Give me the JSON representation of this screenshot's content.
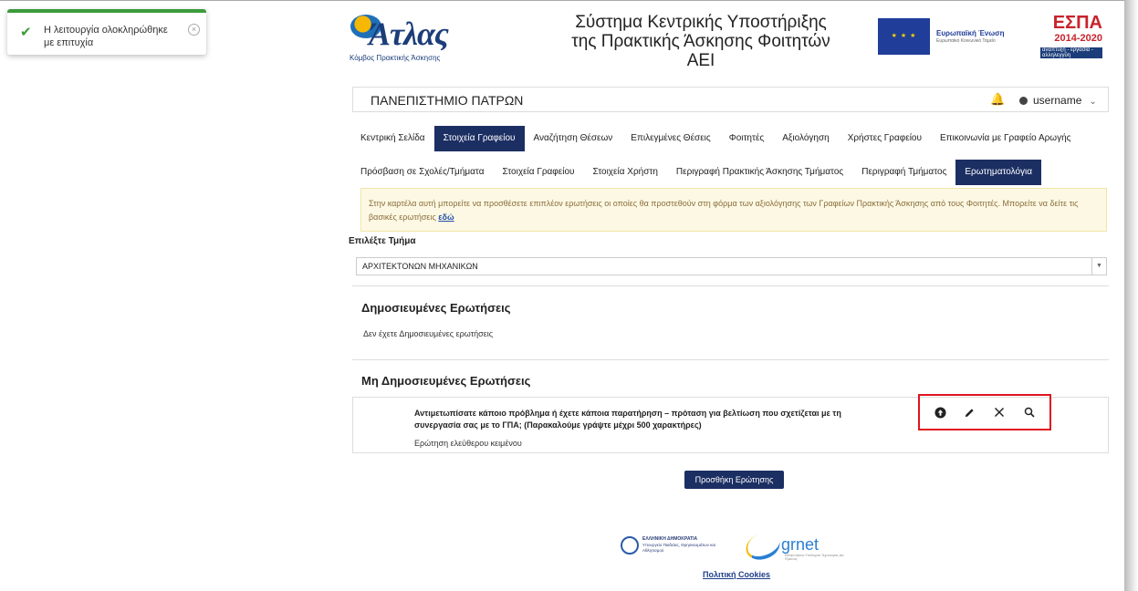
{
  "toast": {
    "message": "Η λειτουργία ολοκληρώθηκε με επιτυχία"
  },
  "header": {
    "logo_name": "Άτλας",
    "logo_sub": "Κόμβος Πρακτικής Άσκησης",
    "site_title": "Σύστημα Κεντρικής Υποστήριξης της Πρακτικής Άσκησης Φοιτητών ΑΕΙ",
    "eu_label": "Ευρωπαϊκή Ένωση",
    "eu_sub": "Ευρωπαϊκό Κοινωνικό Ταμείο",
    "espa_title": "ΕΣΠΑ",
    "espa_years": "2014-2020",
    "espa_tag": "ανάπτυξη - εργασία - αλληλεγγύη"
  },
  "topbar": {
    "institution": "ΠΑΝΕΠΙΣΤΗΜΙΟ ΠΑΤΡΩΝ",
    "username": "username"
  },
  "nav_primary": [
    {
      "label": "Κεντρική Σελίδα",
      "active": false
    },
    {
      "label": "Στοιχεία Γραφείου",
      "active": true
    },
    {
      "label": "Αναζήτηση Θέσεων",
      "active": false
    },
    {
      "label": "Επιλεγμένες Θέσεις",
      "active": false
    },
    {
      "label": "Φοιτητές",
      "active": false
    },
    {
      "label": "Αξιολόγηση",
      "active": false
    },
    {
      "label": "Χρήστες Γραφείου",
      "active": false
    },
    {
      "label": "Επικοινωνία με Γραφείο Αρωγής",
      "active": false
    }
  ],
  "nav_secondary": [
    {
      "label": "Πρόσβαση σε Σχολές/Τμήματα",
      "active": false
    },
    {
      "label": "Στοιχεία Γραφείου",
      "active": false
    },
    {
      "label": "Στοιχεία Χρήστη",
      "active": false
    },
    {
      "label": "Περιγραφή Πρακτικής Άσκησης Τμήματος",
      "active": false
    },
    {
      "label": "Περιγραφή Τμήματος",
      "active": false
    },
    {
      "label": "Ερωτηματολόγια",
      "active": true
    }
  ],
  "alert": {
    "text": "Στην καρτέλα αυτή μπορείτε να προσθέσετε επιπλέον ερωτήσεις οι οποίες θα προστεθούν στη φόρμα των αξιολόγησης των Γραφείων Πρακτικής Άσκησης από τους Φοιτητές. Μπορείτε να δείτε τις βασικές ερωτήσεις ",
    "link": "εδώ"
  },
  "department": {
    "label": "Επιλέξτε Τμήμα",
    "selected": "ΑΡΧΙΤΕΚΤΟΝΩΝ ΜΗΧΑΝΙΚΩΝ"
  },
  "published": {
    "title": "Δημοσιευμένες Ερωτήσεις",
    "empty": "Δεν έχετε Δημοσιευμένες ερωτήσεις"
  },
  "unpublished": {
    "title": "Μη Δημοσιευμένες Ερωτήσεις",
    "question": "Αντιμετωπίσατε κάποιο πρόβλημα ή έχετε κάποια παρατήρηση – πρόταση για βελτίωση που σχετίζεται με τη συνεργασία σας με το ΓΠΑ; (Παρακαλούμε γράψτε μέχρι 500 χαρακτήρες)",
    "type": "Ερώτηση ελεύθερου κειμένου"
  },
  "add_button": "Προσθήκη Ερώτησης",
  "footer": {
    "gov_title": "ΕΛΛΗΝΙΚΗ ΔΗΜΟΚΡΑΤΙΑ",
    "gov_sub": "Υπουργείο Παιδείας, Θρησκευμάτων και Αθλητισμού",
    "grnet": "grnet",
    "grnet_sub": "Εθνικό Δίκτυο Υποδομών Τεχνολογίας και Έρευνας",
    "cookies": "Πολιτική Cookies"
  },
  "icons": [
    "check-icon",
    "close-icon",
    "bell-icon",
    "user-icon",
    "chevron-down-icon",
    "arrow-up-circle-icon",
    "pencil-icon",
    "x-icon",
    "search-icon"
  ],
  "colors": {
    "navy": "#1c2f63",
    "success": "#3c9b3c",
    "highlight": "#e0141e",
    "alert_bg": "#fcf8e3"
  }
}
